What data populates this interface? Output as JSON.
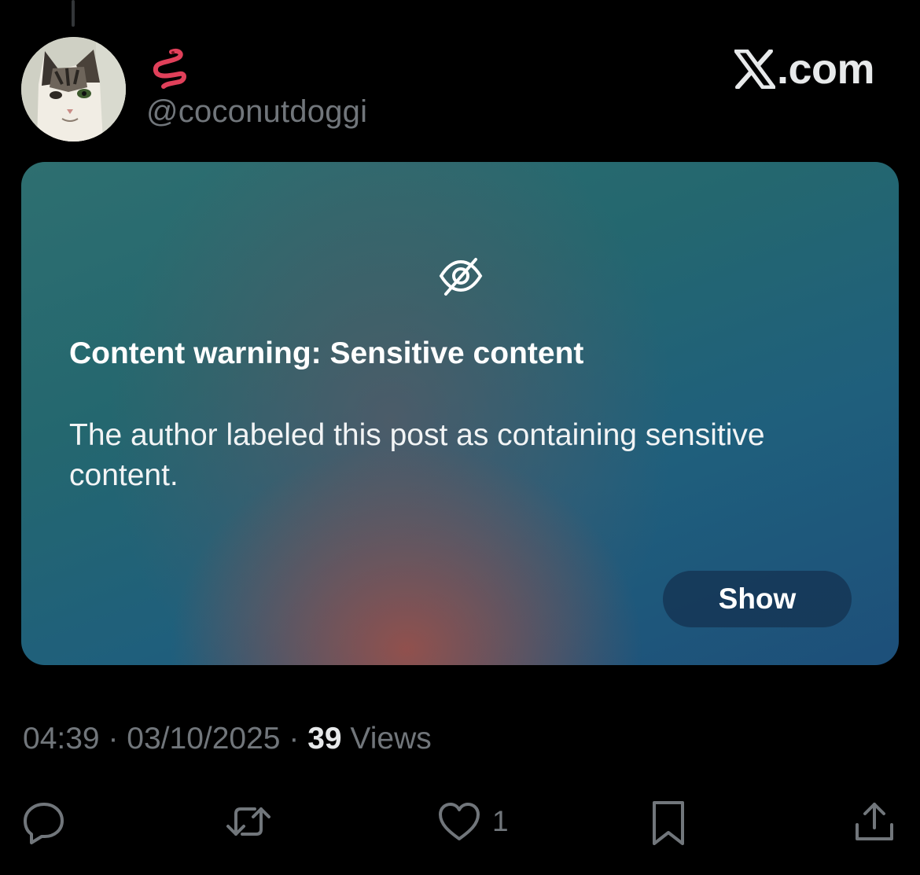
{
  "post": {
    "author_handle": "@coconutdoggi",
    "author_display_name_emoji": "worm-emoji"
  },
  "brand": {
    "text": ".com"
  },
  "content_warning": {
    "title": "Content warning: Sensitive content",
    "body": "The author labeled this post as containing sensitive content.",
    "show_label": "Show"
  },
  "meta": {
    "time": "04:39",
    "separator": "·",
    "date": "03/10/2025",
    "views_count": "39",
    "views_label": "Views"
  },
  "actions": {
    "reply_icon": "reply-icon",
    "repost_icon": "repost-icon",
    "like_icon": "heart-icon",
    "like_count": "1",
    "bookmark_icon": "bookmark-icon",
    "share_icon": "share-icon"
  },
  "colors": {
    "background": "#000000",
    "muted_text": "#71767b",
    "primary_text": "#e7e9ea",
    "card_teal": "#2e6f70",
    "card_blue": "#1d4f7a",
    "card_glow": "#96504b"
  }
}
